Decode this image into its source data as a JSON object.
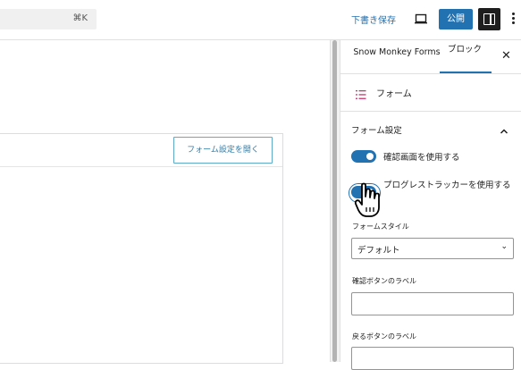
{
  "toolbar": {
    "search_shortcut": "⌘K",
    "save_draft_label": "下書き保存",
    "preview_icon": "laptop-icon",
    "publish_label": "公開",
    "settings_icon": "sidebar-toggle-icon",
    "options_icon": "more-vertical-icon"
  },
  "canvas": {
    "open_settings_label": "フォーム設定を開く"
  },
  "sidebar": {
    "tabs": [
      {
        "label": "Snow Monkey Forms"
      },
      {
        "label": "ブロック",
        "active": true
      }
    ],
    "close_icon": "close-icon",
    "block_card": {
      "icon": "list-icon",
      "name": "フォーム"
    },
    "panel": {
      "title": "フォーム設定",
      "expanded": true,
      "use_confirm_label": "確認画面を使用する",
      "use_confirm_on": true,
      "use_progress_label": "プログレストラッカーを使用する",
      "use_progress_on": true,
      "form_style_label": "フォームスタイル",
      "form_style_value": "デフォルト",
      "confirm_button_label": "確認ボタンのラベル",
      "confirm_button_value": "",
      "back_button_label": "戻るボタンのラベル",
      "back_button_value": ""
    }
  },
  "colors": {
    "accent": "#2271b1",
    "text": "#1e1e1e",
    "block_icon": "#c9356e"
  }
}
